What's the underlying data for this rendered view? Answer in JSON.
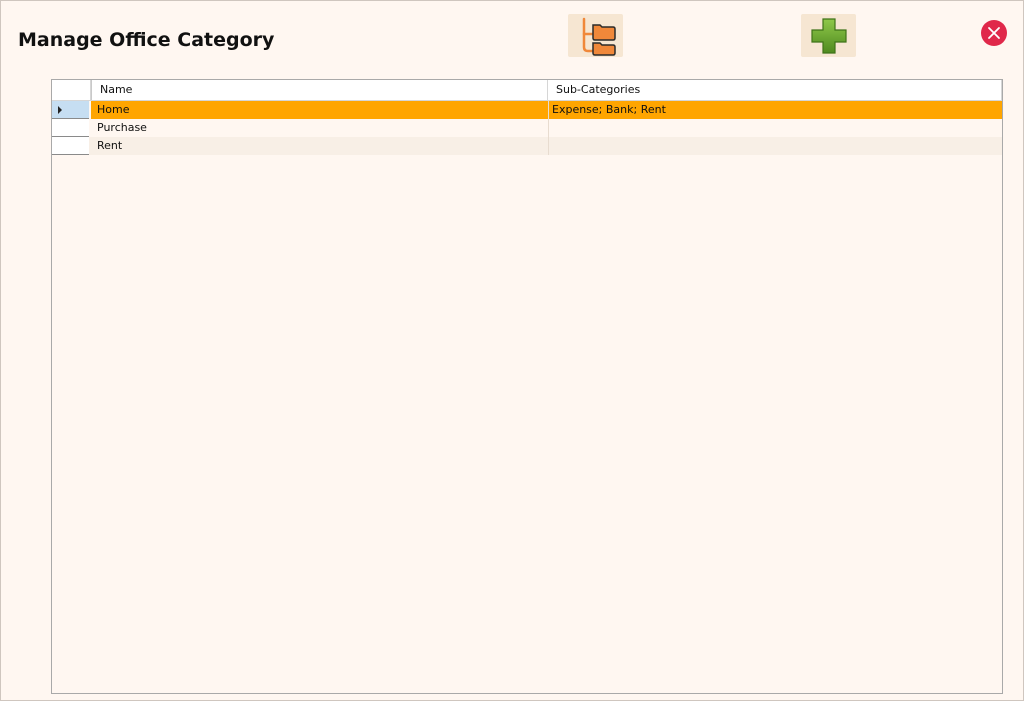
{
  "window": {
    "title": "Manage Office Category"
  },
  "toolbar": {
    "tree_icon": "category-tree-icon",
    "add_icon": "plus-icon",
    "close_icon": "close-icon"
  },
  "grid": {
    "columns": [
      "Name",
      "Sub-Categories"
    ],
    "rows": [
      {
        "name": "Home",
        "sub_categories": "Expense; Bank; Rent"
      },
      {
        "name": "Purchase",
        "sub_categories": ""
      },
      {
        "name": "Rent",
        "sub_categories": ""
      }
    ],
    "selected_row": 0
  },
  "colors": {
    "background": "#fff7f1",
    "selected_row": "#ffa500",
    "close_button": "#e0284a",
    "add_icon": "#6aa52a",
    "tree_icon": "#f0883a"
  }
}
